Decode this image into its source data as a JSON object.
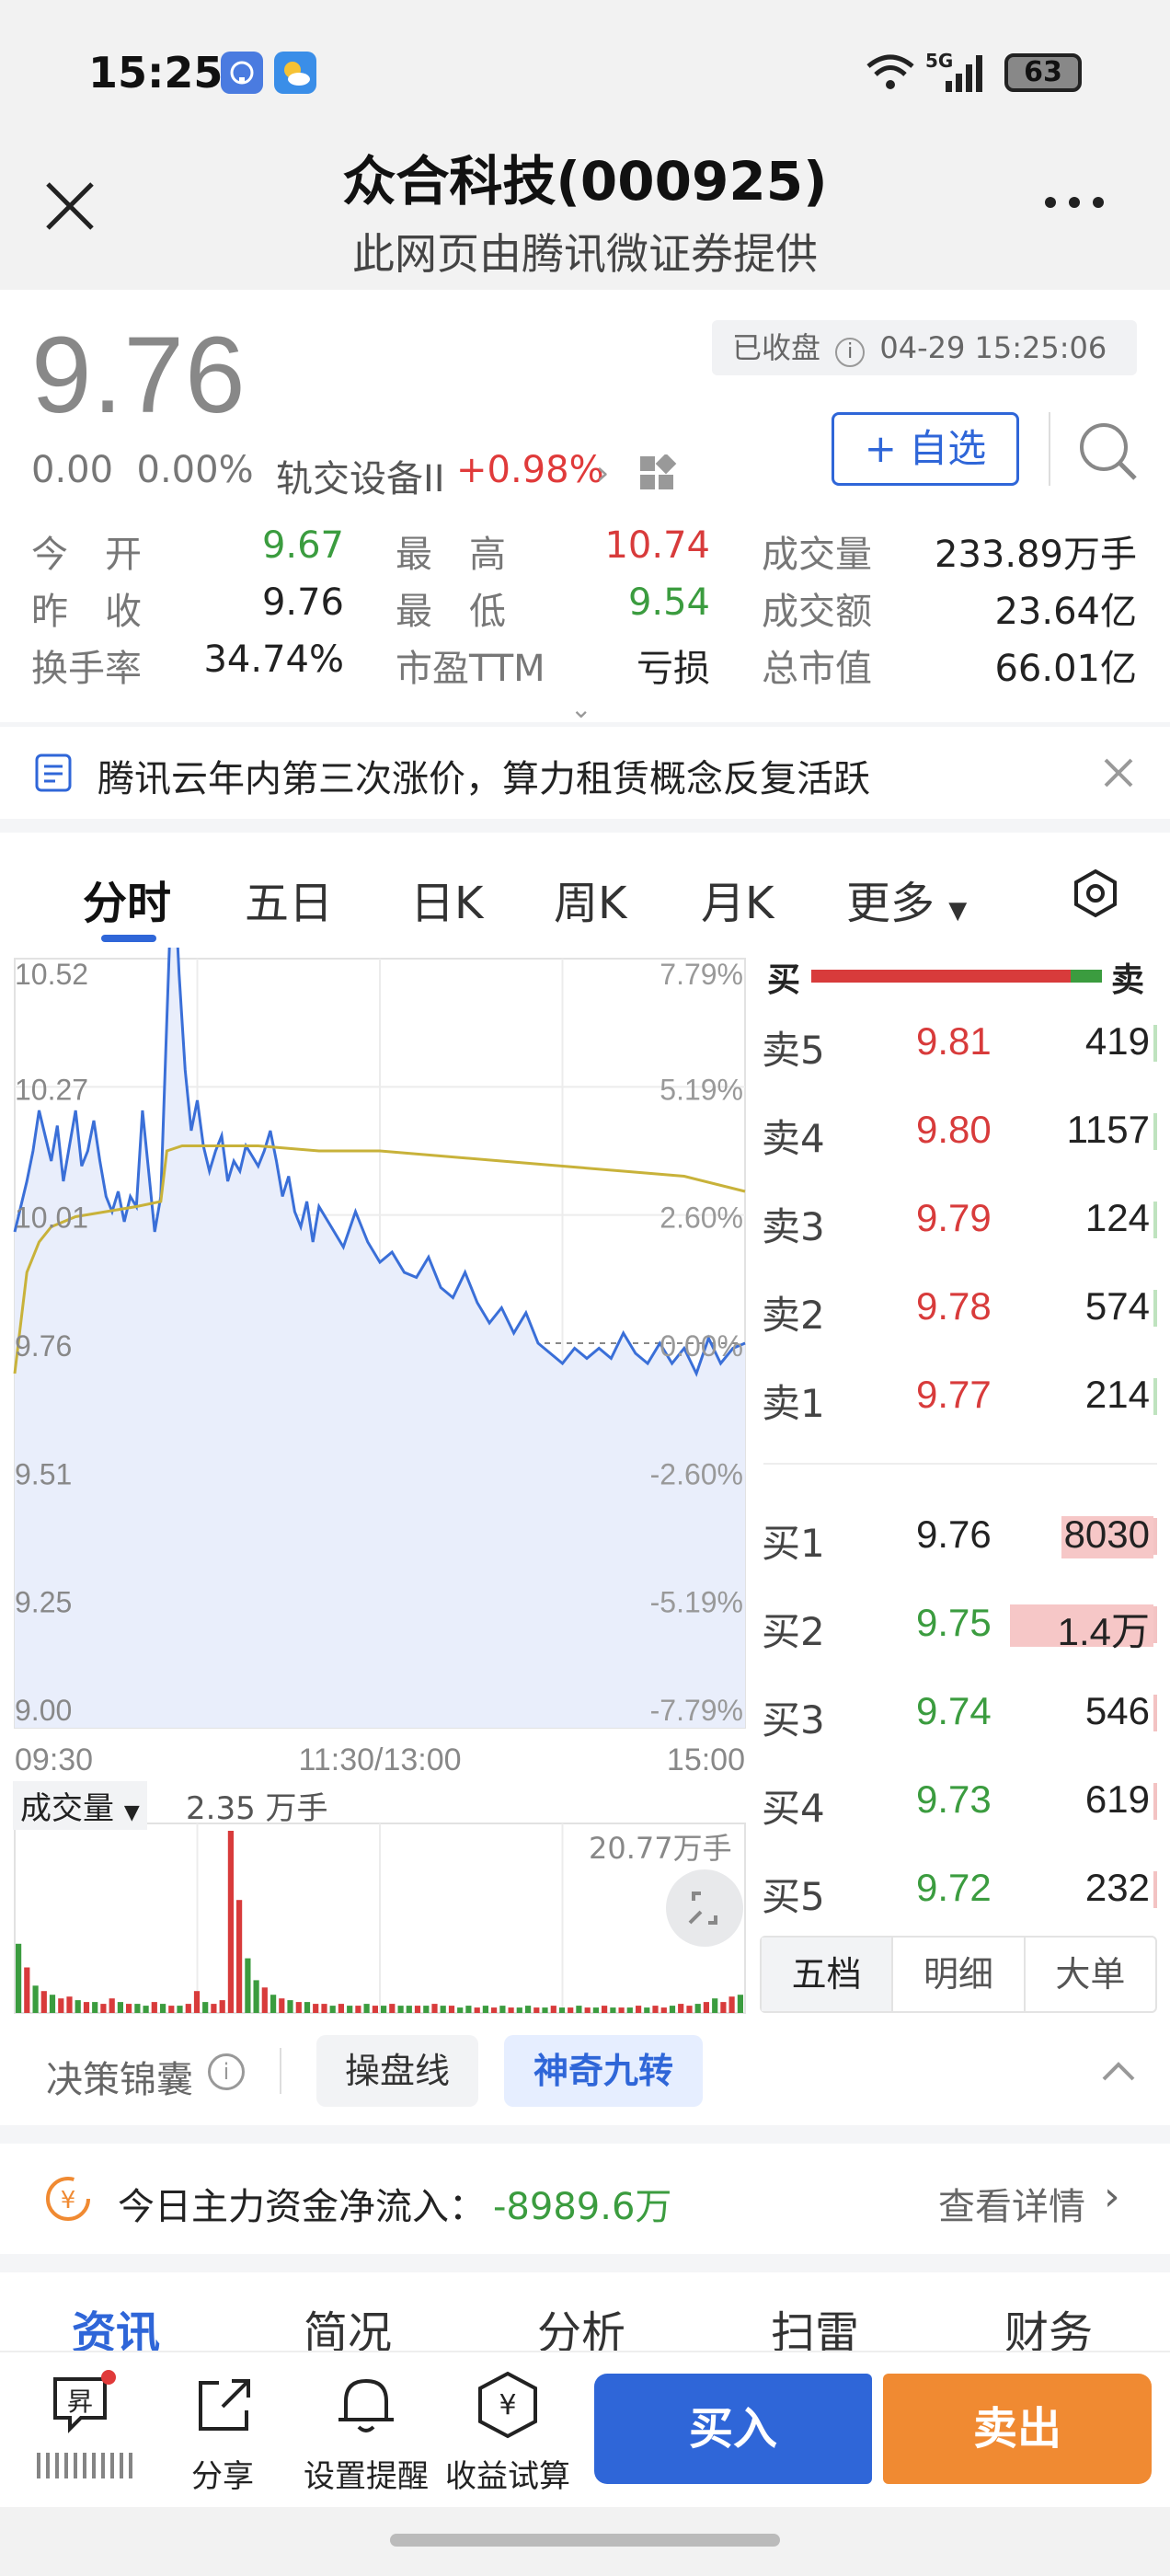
{
  "status_bar": {
    "time": "15:25",
    "network": "5G",
    "battery": "63"
  },
  "header": {
    "title": "众合科技(000925)",
    "subtitle": "此网页由腾讯微证券提供"
  },
  "quote": {
    "price": "9.76",
    "change": "0.00",
    "change_pct": "0.00%",
    "sector": "轨交设备II",
    "sector_change": "+0.98%",
    "market_status": "已收盘",
    "datetime": "04-29 15:25:06",
    "watch_label": "+ 自选",
    "stats": [
      {
        "label": "今　开",
        "value": "9.67",
        "color": "g"
      },
      {
        "label": "最　高",
        "value": "10.74",
        "color": "r"
      },
      {
        "label": "成交量",
        "value": "233.89万手",
        "color": "k"
      },
      {
        "label": "昨　收",
        "value": "9.76",
        "color": "k"
      },
      {
        "label": "最　低",
        "value": "9.54",
        "color": "g"
      },
      {
        "label": "成交额",
        "value": "23.64亿",
        "color": "k"
      },
      {
        "label": "换手率",
        "value": "34.74%",
        "color": "k"
      },
      {
        "label": "市盈TTM",
        "value": "亏损",
        "color": "k"
      },
      {
        "label": "总市值",
        "value": "66.01亿",
        "color": "k"
      }
    ]
  },
  "news": {
    "text": "腾讯云年内第三次涨价，算力租赁概念反复活跃"
  },
  "chart_tabs": [
    "分时",
    "五日",
    "日K",
    "周K",
    "月K",
    "更多"
  ],
  "chart_data": {
    "type": "line",
    "title": "",
    "x_ticks": [
      "09:30",
      "11:30/13:00",
      "15:00"
    ],
    "y_ticks_price": [
      "10.52",
      "10.27",
      "10.01",
      "9.76",
      "9.51",
      "9.25",
      "9.00"
    ],
    "y_ticks_pct": [
      "7.79%",
      "5.19%",
      "2.60%",
      "0.00%",
      "-2.60%",
      "-5.19%",
      "-7.79%"
    ],
    "ylim": [
      9.0,
      10.52
    ],
    "prev_close": 9.76,
    "series": [
      {
        "name": "price",
        "color": "#3a6fd8",
        "x": [
          0,
          2,
          4,
          6,
          8,
          10,
          12,
          14,
          16,
          18,
          20,
          22,
          24,
          26,
          28,
          30,
          32,
          34,
          36,
          38,
          40,
          42,
          44,
          46,
          48,
          50,
          52,
          54,
          56,
          58,
          60,
          62,
          64,
          66,
          68,
          70,
          72,
          74,
          76,
          78,
          80,
          82,
          84,
          86,
          88,
          90,
          92,
          94,
          96,
          98,
          100,
          104,
          108,
          112,
          116,
          120,
          124,
          128,
          132,
          136,
          140,
          144,
          148,
          152,
          156,
          160,
          164,
          168,
          172,
          176,
          180,
          184,
          188,
          192,
          196,
          200,
          204,
          208,
          212,
          216,
          220,
          224,
          228,
          232,
          236,
          240
        ],
        "values": [
          9.98,
          10.03,
          10.08,
          10.14,
          10.22,
          10.17,
          10.12,
          10.19,
          10.08,
          10.15,
          10.22,
          10.11,
          10.14,
          10.2,
          10.12,
          10.05,
          10.02,
          10.06,
          10.0,
          10.05,
          10.03,
          10.22,
          10.1,
          9.98,
          10.05,
          10.4,
          10.74,
          10.49,
          10.3,
          10.18,
          10.24,
          10.15,
          10.1,
          10.14,
          10.17,
          10.08,
          10.12,
          10.1,
          10.15,
          10.13,
          10.11,
          10.14,
          10.18,
          10.12,
          10.05,
          10.09,
          10.02,
          9.99,
          10.04,
          9.96,
          10.03,
          9.99,
          9.95,
          10.02,
          9.96,
          9.92,
          9.94,
          9.9,
          9.89,
          9.93,
          9.87,
          9.85,
          9.9,
          9.84,
          9.8,
          9.83,
          9.78,
          9.82,
          9.76,
          9.74,
          9.72,
          9.75,
          9.73,
          9.75,
          9.73,
          9.78,
          9.74,
          9.72,
          9.76,
          9.72,
          9.75,
          9.7,
          9.77,
          9.72,
          9.75,
          9.76
        ]
      },
      {
        "name": "avg",
        "color": "#c8b23a",
        "x": [
          0,
          4,
          8,
          12,
          20,
          30,
          40,
          48,
          50,
          55,
          60,
          80,
          100,
          120,
          140,
          160,
          180,
          200,
          220,
          240
        ],
        "values": [
          9.7,
          9.9,
          9.96,
          9.99,
          10.01,
          10.02,
          10.03,
          10.04,
          10.14,
          10.15,
          10.15,
          10.15,
          10.14,
          10.14,
          10.13,
          10.12,
          10.11,
          10.1,
          10.09,
          10.06
        ]
      }
    ],
    "volume": {
      "label": "成交量",
      "current": "2.35 万手",
      "max_label": "20.77万手",
      "bars": [
        0.38,
        0.25,
        0.15,
        0.12,
        0.1,
        0.08,
        0.09,
        0.07,
        0.06,
        0.06,
        0.05,
        0.08,
        0.06,
        0.05,
        0.05,
        0.04,
        0.06,
        0.05,
        0.04,
        0.04,
        0.05,
        0.12,
        0.06,
        0.05,
        0.07,
        1.0,
        0.62,
        0.3,
        0.18,
        0.14,
        0.1,
        0.08,
        0.07,
        0.06,
        0.06,
        0.05,
        0.05,
        0.04,
        0.05,
        0.04,
        0.04,
        0.05,
        0.04,
        0.04,
        0.05,
        0.04,
        0.04,
        0.04,
        0.04,
        0.05,
        0.04,
        0.04,
        0.03,
        0.04,
        0.03,
        0.04,
        0.03,
        0.04,
        0.03,
        0.03,
        0.04,
        0.03,
        0.03,
        0.04,
        0.03,
        0.03,
        0.04,
        0.03,
        0.03,
        0.04,
        0.03,
        0.03,
        0.03,
        0.04,
        0.03,
        0.04,
        0.03,
        0.04,
        0.05,
        0.04,
        0.05,
        0.06,
        0.08,
        0.06,
        0.09,
        0.1
      ],
      "up": [
        0,
        1,
        0,
        1,
        0,
        1,
        1,
        0,
        1,
        0,
        1,
        1,
        0,
        1,
        0,
        0,
        1,
        0,
        1,
        0,
        1,
        1,
        0,
        1,
        1,
        1,
        1,
        0,
        0,
        1,
        0,
        1,
        0,
        1,
        0,
        1,
        1,
        0,
        1,
        0,
        1,
        0,
        1,
        0,
        1,
        0,
        0,
        1,
        0,
        1,
        0,
        1,
        0,
        0,
        1,
        0,
        1,
        0,
        1,
        0,
        0,
        1,
        0,
        1,
        0,
        1,
        0,
        1,
        0,
        1,
        0,
        1,
        0,
        1,
        0,
        1,
        1,
        0,
        1,
        1,
        0,
        1,
        0,
        1,
        1,
        0
      ]
    }
  },
  "order_book": {
    "buy_label": "买",
    "sell_label": "卖",
    "asks": [
      {
        "label": "卖5",
        "price": "9.81",
        "vol": "419"
      },
      {
        "label": "卖4",
        "price": "9.80",
        "vol": "1157"
      },
      {
        "label": "卖3",
        "price": "9.79",
        "vol": "124"
      },
      {
        "label": "卖2",
        "price": "9.78",
        "vol": "574"
      },
      {
        "label": "卖1",
        "price": "9.77",
        "vol": "214"
      }
    ],
    "bids": [
      {
        "label": "买1",
        "price": "9.76",
        "vol": "8030"
      },
      {
        "label": "买2",
        "price": "9.75",
        "vol": "1.4万"
      },
      {
        "label": "买3",
        "price": "9.74",
        "vol": "546"
      },
      {
        "label": "买4",
        "price": "9.73",
        "vol": "619"
      },
      {
        "label": "买5",
        "price": "9.72",
        "vol": "232"
      }
    ],
    "tabs": [
      "五档",
      "明细",
      "大单"
    ]
  },
  "tools": {
    "title": "决策锦囊",
    "chip1": "操盘线",
    "chip2": "神奇九转"
  },
  "funds": {
    "label": "今日主力资金净流入：",
    "value": "-8989.6万",
    "details": "查看详情"
  },
  "sub_tabs": [
    "资讯",
    "简况",
    "分析",
    "扫雷",
    "财务"
  ],
  "bottom_bar": {
    "share": "分享",
    "alert": "设置提醒",
    "calc": "收益试算",
    "buy": "买入",
    "sell": "卖出"
  },
  "colors": {
    "accent": "#2f66d8",
    "up": "#d83b3b",
    "down": "#3b9c3f",
    "sell_btn": "#f08a32"
  }
}
